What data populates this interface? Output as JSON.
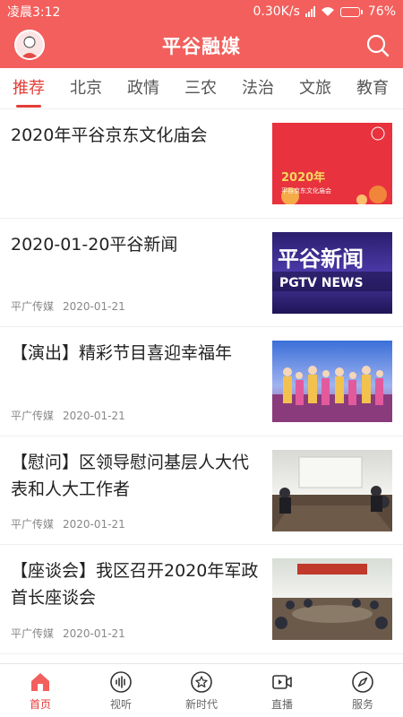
{
  "status": {
    "time": "凌晨3:12",
    "speed": "0.30K/s",
    "battery": "76%",
    "battery_level": 0.76
  },
  "appbar": {
    "title": "平谷融媒",
    "brand_color": "#f25f5c"
  },
  "tabs": [
    {
      "label": "推荐",
      "active": true
    },
    {
      "label": "北京"
    },
    {
      "label": "政情"
    },
    {
      "label": "三农"
    },
    {
      "label": "法治"
    },
    {
      "label": "文旅"
    },
    {
      "label": "教育"
    }
  ],
  "feed": {
    "items": [
      {
        "title": "2020年平谷京东文化庙会",
        "thumb_text": "2020年",
        "thumb_sub": "平谷京东文化庙会"
      },
      {
        "title": "2020-01-20平谷新闻",
        "source": "平广传媒",
        "date": "2020-01-21",
        "thumb_text": "平谷新闻",
        "thumb_sub": "PGTV NEWS"
      },
      {
        "title": "【演出】精彩节目喜迎幸福年",
        "source": "平广传媒",
        "date": "2020-01-21"
      },
      {
        "title": "【慰问】区领导慰问基层人大代表和人大工作者",
        "source": "平广传媒",
        "date": "2020-01-21"
      },
      {
        "title": "【座谈会】我区召开2020年军政首长座谈会",
        "source": "平广传媒",
        "date": "2020-01-21"
      }
    ]
  },
  "bottomnav": [
    {
      "label": "首页",
      "icon": "home-icon",
      "active": true
    },
    {
      "label": "视听",
      "icon": "audio-wave-icon"
    },
    {
      "label": "新时代",
      "icon": "star-badge-icon"
    },
    {
      "label": "直播",
      "icon": "video-camera-icon"
    },
    {
      "label": "服务",
      "icon": "compass-icon"
    }
  ],
  "accent_color": "#e33c35"
}
